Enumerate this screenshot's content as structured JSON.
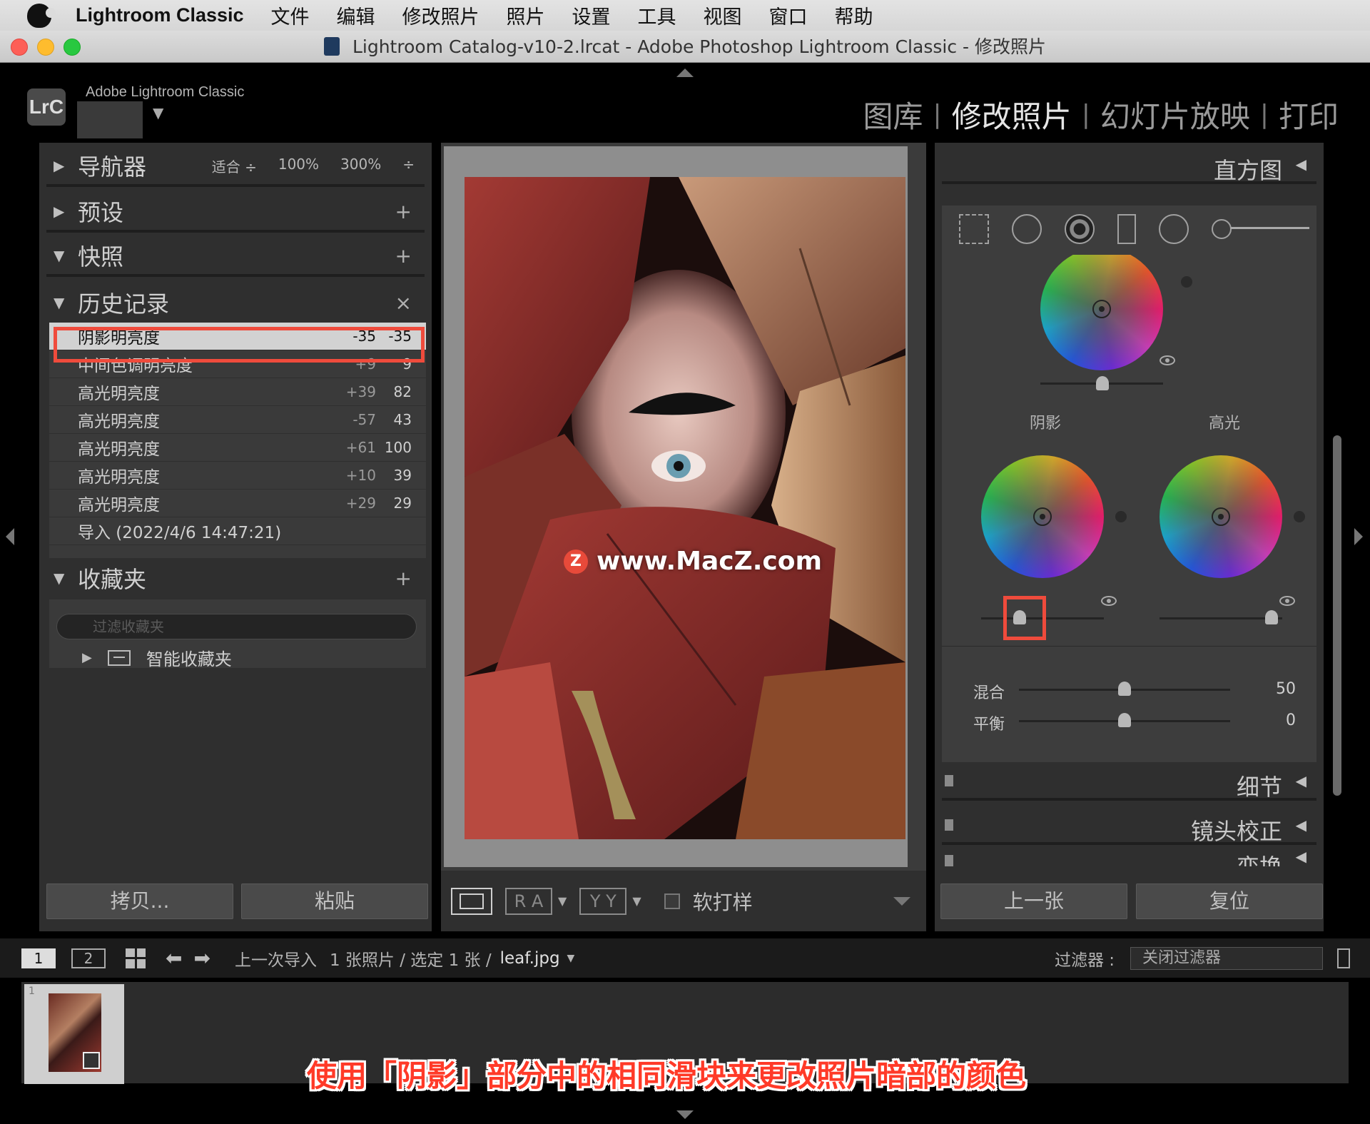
{
  "menubar": {
    "app": "Lightroom Classic",
    "items": [
      "文件",
      "编辑",
      "修改照片",
      "照片",
      "设置",
      "工具",
      "视图",
      "窗口",
      "帮助"
    ]
  },
  "window": {
    "title": "Lightroom Catalog-v10-2.lrcat - Adobe Photoshop Lightroom Classic - 修改照片"
  },
  "identity": {
    "logo": "LrC",
    "brand": "Adobe Lightroom Classic"
  },
  "modules": {
    "library": "图库",
    "develop": "修改照片",
    "slideshow": "幻灯片放映",
    "print": "打印",
    "separator": "|"
  },
  "left": {
    "navigator": {
      "title": "导航器",
      "zoom": [
        "适合 ÷",
        "100%",
        "300%",
        "÷"
      ]
    },
    "presets": {
      "title": "预设",
      "action": "+"
    },
    "snapshots": {
      "title": "快照",
      "action": "+"
    },
    "history": {
      "title": "历史记录",
      "action": "×",
      "items": [
        {
          "label": "阴影明亮度",
          "delta": "-35",
          "value": "-35"
        },
        {
          "label": "中间色调明亮度",
          "delta": "+9",
          "value": "9"
        },
        {
          "label": "高光明亮度",
          "delta": "+39",
          "value": "82"
        },
        {
          "label": "高光明亮度",
          "delta": "-57",
          "value": "43"
        },
        {
          "label": "高光明亮度",
          "delta": "+61",
          "value": "100"
        },
        {
          "label": "高光明亮度",
          "delta": "+10",
          "value": "39"
        },
        {
          "label": "高光明亮度",
          "delta": "+29",
          "value": "29"
        },
        {
          "label": "导入 (2022/4/6 14:47:21)",
          "delta": "",
          "value": ""
        }
      ]
    },
    "collections": {
      "title": "收藏夹",
      "action": "+",
      "filter_placeholder": "过滤收藏夹",
      "smart": "智能收藏夹"
    },
    "copy_button": "拷贝...",
    "paste_button": "粘贴"
  },
  "right": {
    "histogram": "直方图",
    "grading": {
      "shadows": "阴影",
      "highlights": "高光",
      "blending_label": "混合",
      "blending_value": "50",
      "balance_label": "平衡",
      "balance_value": "0"
    },
    "detail": "细节",
    "lens": "镜头校正",
    "transform": "变换",
    "prev_button": "上一张",
    "reset_button": "复位"
  },
  "toolbar": {
    "ra": "R A",
    "yy": "Y Y",
    "soft_proof": "软打样"
  },
  "filmstrip": {
    "view1": "1",
    "view2": "2",
    "source": "上一次导入",
    "info": "1 张照片 / 选定 1 张 /",
    "filename": "leaf.jpg",
    "filter_label": "过滤器 :",
    "filter_value": "关闭过滤器",
    "thumb_index": "1"
  },
  "watermark": "www.MacZ.com",
  "caption": "使用「阴影」部分中的相同滑块来更改照片暗部的颜色"
}
